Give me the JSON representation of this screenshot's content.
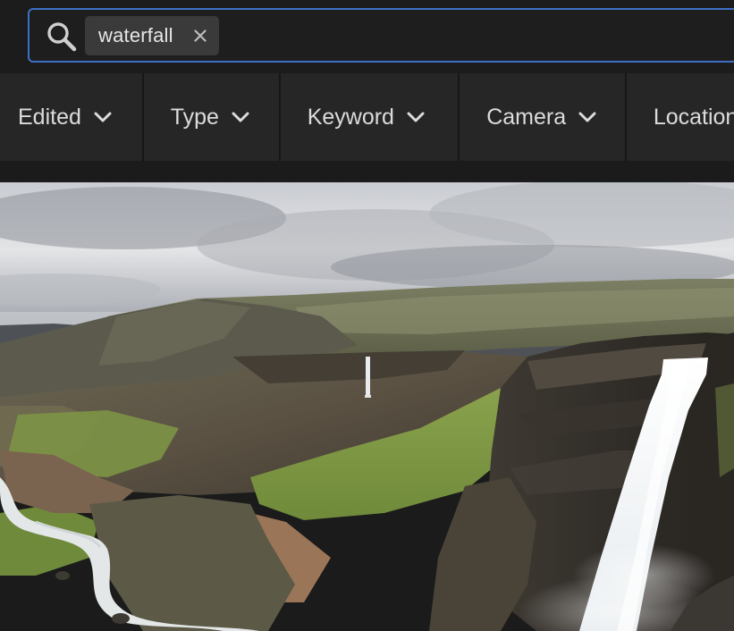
{
  "search": {
    "chip_label": "waterfall"
  },
  "filters": [
    {
      "label": "Edited"
    },
    {
      "label": "Type"
    },
    {
      "label": "Keyword"
    },
    {
      "label": "Camera"
    },
    {
      "label": "Location"
    }
  ],
  "colors": {
    "focus_border": "#3d6fc4",
    "chip_bg": "#3a3a3a",
    "filter_bg": "#262626"
  },
  "photo": {
    "subject": "waterfall-canyon-photo"
  }
}
